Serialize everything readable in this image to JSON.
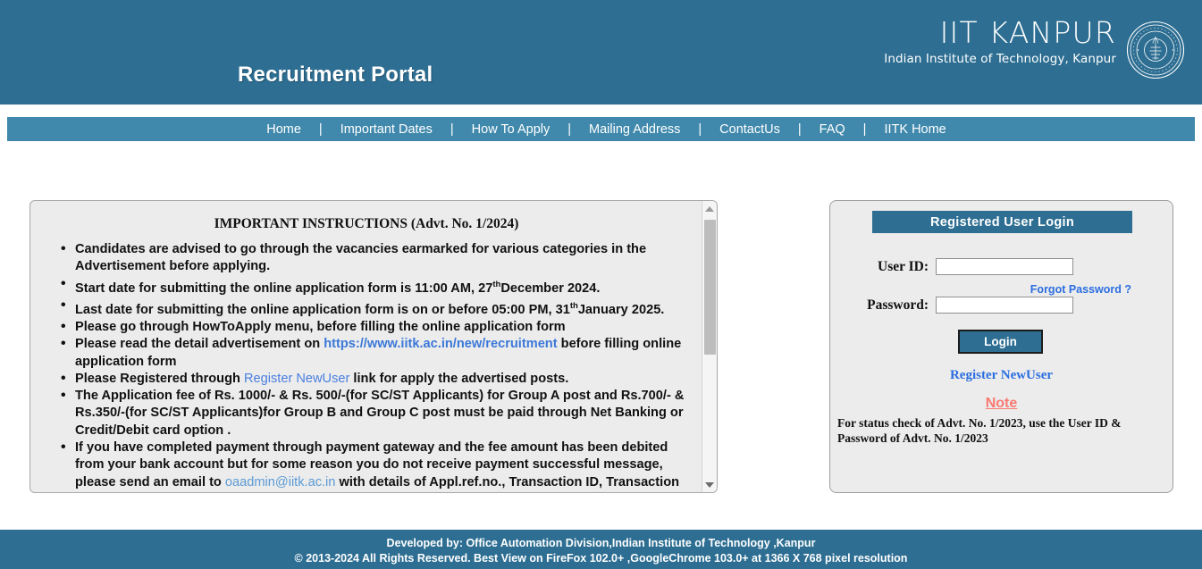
{
  "header": {
    "portal_title": "Recruitment Portal",
    "brand_main": "IIT KANPUR",
    "brand_sub": "Indian Institute of Technology, Kanpur",
    "seal_icon": "iitk-seal-icon",
    "bg_color": "#2d6e92"
  },
  "nav": {
    "separator": "|",
    "bg_color": "#4089ac",
    "items": [
      {
        "label": "Home"
      },
      {
        "label": "Important Dates"
      },
      {
        "label": "How To Apply"
      },
      {
        "label": "Mailing Address"
      },
      {
        "label": "ContactUs"
      },
      {
        "label": "FAQ"
      },
      {
        "label": "IITK Home"
      }
    ]
  },
  "instructions": {
    "title": "IMPORTANT INSTRUCTIONS (Advt. No. 1/2024)",
    "red_color": "#fa7a72",
    "link_color": "#3b78d8",
    "items": [
      {
        "style": "red",
        "parts": [
          {
            "t": "text",
            "v": "Candidates are advised to go through the vacancies earmarked for various categories in the Advertisement before applying."
          }
        ]
      },
      {
        "style": "red",
        "parts": [
          {
            "t": "text",
            "v": "Start date for submitting the online application form is 11:00 AM, 27"
          },
          {
            "t": "sup",
            "v": "th"
          },
          {
            "t": "text",
            "v": "December 2024."
          }
        ]
      },
      {
        "style": "red",
        "parts": [
          {
            "t": "text",
            "v": "Last date for submitting the online application form is on or before 05:00 PM, 31"
          },
          {
            "t": "sup",
            "v": "th"
          },
          {
            "t": "text",
            "v": "January 2025."
          }
        ]
      },
      {
        "style": "normal",
        "parts": [
          {
            "t": "text",
            "v": "Please go through HowToApply menu, before filling the online application form"
          }
        ]
      },
      {
        "style": "normal",
        "parts": [
          {
            "t": "text",
            "v": "Please read the detail advertisement on "
          },
          {
            "t": "link",
            "v": "https://www.iitk.ac.in/new/recruitment"
          },
          {
            "t": "text",
            "v": " before filling online application form"
          }
        ]
      },
      {
        "style": "normal",
        "parts": [
          {
            "t": "text",
            "v": "Please Registered through "
          },
          {
            "t": "link-reg",
            "v": "Register NewUser"
          },
          {
            "t": "text",
            "v": " link for apply the advertised posts."
          }
        ]
      },
      {
        "style": "normal",
        "parts": [
          {
            "t": "text",
            "v": "The Application fee of Rs. 1000/- & Rs. 500/-(for SC/ST Applicants) for Group A post and Rs.700/- & Rs.350/-(for SC/ST Applicants)for Group B and Group C post must be paid through Net Banking or Credit/Debit card option ."
          }
        ]
      },
      {
        "style": "normal",
        "parts": [
          {
            "t": "text",
            "v": "If you have completed payment through payment gateway and the fee amount has been debited from your bank account but for some reason you do not receive payment successful message, please send an email to "
          },
          {
            "t": "link-mail",
            "v": "oaadmin@iitk.ac.in"
          },
          {
            "t": "text",
            "v": " with details of Appl.ref.no., Transaction ID, Transaction date, Bank Name, Pay Mode (Net Banking or Credit/Debit Card). Do not Refresh the page or click the Back link on your"
          }
        ]
      }
    ],
    "scrollbar": {
      "up_icon": "scroll-up-arrow-icon",
      "down_icon": "scroll-down-arrow-icon"
    }
  },
  "login": {
    "panel_title": "Registered User Login",
    "userid_label": "User ID:",
    "userid_value": "",
    "userid_placeholder": "",
    "password_label": "Password:",
    "password_value": "",
    "password_placeholder": "",
    "forgot_password_label": "Forgot Password ?",
    "login_button_label": "Login",
    "register_link_label": "Register NewUser",
    "note_title": "Note",
    "note_body": "For status check of Advt. No. 1/2023, use the User ID & Password of Advt. No. 1/2023",
    "header_color": "#2d6e92",
    "link_color": "#2b6ee0"
  },
  "footer": {
    "line1": "Developed by: Office Automation Division,Indian Institute of Technology ,Kanpur",
    "line2": "© 2013-2024 All Rights Reserved. Best View on FireFox 102.0+ ,GoogleChrome 103.0+ at 1366 X 768 pixel resolution",
    "bg_color": "#2d6e92"
  }
}
